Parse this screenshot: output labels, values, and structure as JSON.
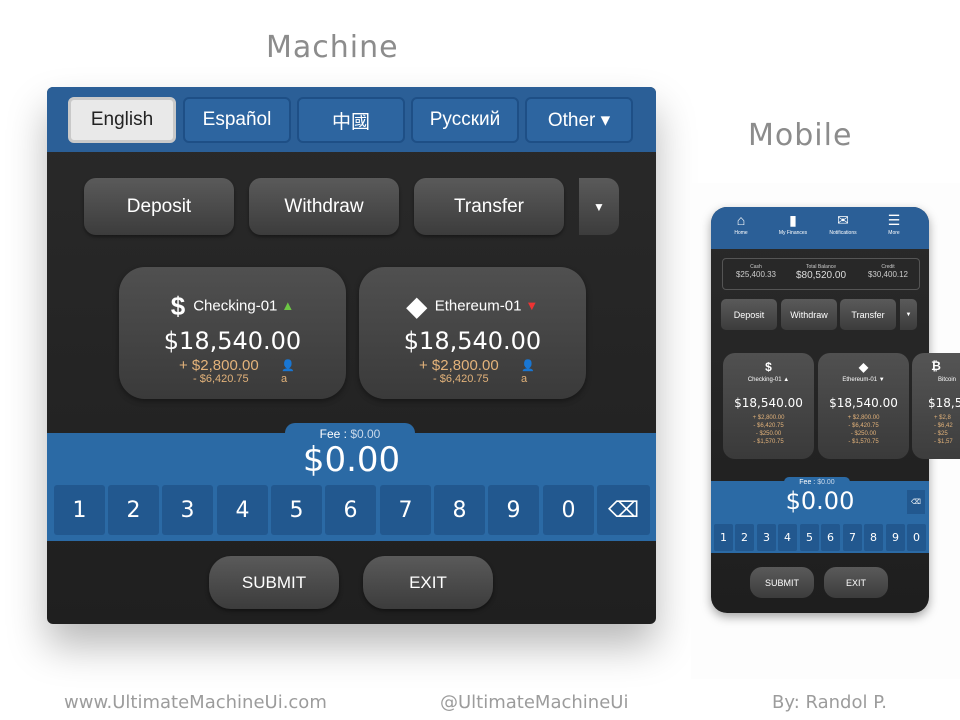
{
  "headings": {
    "machine": "Machine",
    "mobile": "Mobile"
  },
  "machine": {
    "languages": [
      {
        "label": "English",
        "active": true
      },
      {
        "label": "Español",
        "active": false
      },
      {
        "label": "中國",
        "active": false
      },
      {
        "label": "Русский",
        "active": false
      },
      {
        "label": "Other ▾",
        "active": false
      }
    ],
    "actions": [
      "Deposit",
      "Withdraw",
      "Transfer"
    ],
    "actions_more_icon": "▼",
    "accounts": [
      {
        "icon": "dollar-icon",
        "glyph": "$",
        "name": "Checking-01",
        "trend": "▲",
        "trend_dir": "up",
        "balance": "$18,540.00",
        "plus": "+ $2,800.00",
        "minus": "- $6,420.75",
        "icon_person": "👤",
        "icon_amazon": "a"
      },
      {
        "icon": "ethereum-icon",
        "glyph": "◆",
        "name": "Ethereum-01",
        "trend": "▼",
        "trend_dir": "down",
        "balance": "$18,540.00",
        "plus": "+ $2,800.00",
        "minus": "- $6,420.75",
        "icon_person": "👤",
        "icon_amazon": "a"
      }
    ],
    "fee_label": "Fee :",
    "fee_value": "$0.00",
    "amount": "$0.00",
    "keypad": [
      "1",
      "2",
      "3",
      "4",
      "5",
      "6",
      "7",
      "8",
      "9",
      "0"
    ],
    "backspace_icon": "⌫",
    "submit": "SUBMIT",
    "exit": "EXIT"
  },
  "mobile": {
    "nav": [
      {
        "icon": "⌂",
        "label": "Home"
      },
      {
        "icon": "▮",
        "label": "My Finances"
      },
      {
        "icon": "✉",
        "label": "Notifications"
      },
      {
        "icon": "☰",
        "label": "More"
      }
    ],
    "balances": [
      {
        "label": "Cash",
        "value": "$25,400.33"
      },
      {
        "label": "Total Balance",
        "value": "$80,520.00"
      },
      {
        "label": "Credit",
        "value": "$30,400.12"
      }
    ],
    "actions": [
      "Deposit",
      "Withdraw",
      "Transfer"
    ],
    "actions_more_icon": "▼",
    "accounts": [
      {
        "glyph": "$",
        "name": "Checking-01 ▲",
        "balance": "$18,540.00",
        "lines": [
          "+ $2,800.00",
          "- $6,420.75",
          "- $250.00",
          "- $1,570.75"
        ]
      },
      {
        "glyph": "◆",
        "name": "Ethereum-01 ▼",
        "balance": "$18,540.00",
        "lines": [
          "+ $2,800.00",
          "- $6,420.75",
          "- $250.00",
          "- $1,570.75"
        ]
      }
    ],
    "partial_card": {
      "glyph": "₿",
      "name": "Bitcoin",
      "balance": "$18,5",
      "lines": [
        "+ $2,8",
        "- $6,42",
        "- $25",
        "- $1,57"
      ]
    },
    "fee_label": "Fee :",
    "fee_value": "$0.00",
    "amount": "$0.00",
    "backspace_icon": "⌫",
    "keypad": [
      "1",
      "2",
      "3",
      "4",
      "5",
      "6",
      "7",
      "8",
      "9",
      "0"
    ],
    "submit": "SUBMIT",
    "exit": "EXIT"
  },
  "footer": {
    "website": "www.UltimateMachineUi.com",
    "handle": "@UltimateMachineUi",
    "author": "By: Randol P."
  },
  "colors": {
    "primary_blue": "#2b5f97",
    "amount_blue": "#2b6aa5",
    "accent_gold": "#e2b27a",
    "up_green": "#6cc644",
    "down_red": "#e33"
  }
}
